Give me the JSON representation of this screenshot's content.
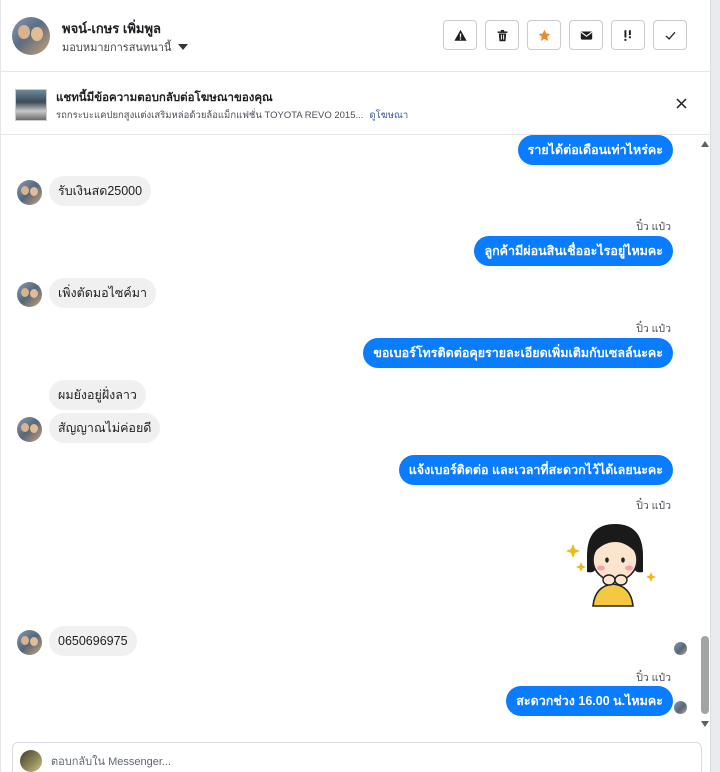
{
  "header": {
    "contact_name": "พจน์-เกษร เพิ่มพูล",
    "assign_label": "มอบหมายการสนทนานี้",
    "actions": [
      {
        "name": "report-icon",
        "label": "warning"
      },
      {
        "name": "trash-icon",
        "label": "delete"
      },
      {
        "name": "star-icon",
        "label": "star",
        "color": "#f08a24"
      },
      {
        "name": "mail-icon",
        "label": "mark unread"
      },
      {
        "name": "follow-up-icon",
        "label": "follow up"
      },
      {
        "name": "check-icon",
        "label": "done"
      }
    ]
  },
  "ad_banner": {
    "title": "แชทนี้มีข้อความตอบกลับต่อโฆษณาของคุณ",
    "subtitle": "รถกระบะแคปยกสูงแต่งเสริมหล่อด้วยล้อแม็กแฟชั่น TOYOTA REVO 2015...",
    "link": "ดูโฆษณา"
  },
  "messages": [
    {
      "dir": "out",
      "text": "รายได้ต่อเดือนเท่าไหร่คะ"
    },
    {
      "dir": "in",
      "text": "รับเงินสด25000"
    },
    {
      "dir": "out",
      "sender": "ปิ๋ว แป๋ว",
      "text": "ลูกค้ามีผ่อนสินเชื่ออะไรอยู่ไหมคะ"
    },
    {
      "dir": "in",
      "text": "เพิ่งตัดมอไซค์มา"
    },
    {
      "dir": "out",
      "sender": "ปิ๋ว แป๋ว",
      "text": "ขอเบอร์โทรติดต่อคุยรายละเอียดเพิ่มเติมกับเซลล์นะคะ"
    },
    {
      "dir": "in",
      "text": "ผมยังอยู่ฝั่งลาว"
    },
    {
      "dir": "in",
      "text": "สัญญาณไม่ค่อยดี"
    },
    {
      "dir": "out",
      "text": "แจ้งเบอร์ติดต่อ  และเวลาที่สะดวกไว้ได้เลยนะคะ"
    },
    {
      "dir": "out",
      "sender": "ปิ๋ว แป๋ว",
      "type": "sticker"
    },
    {
      "dir": "in",
      "text": "0650696975"
    },
    {
      "dir": "out",
      "sender": "ปิ๋ว แป๋ว",
      "text": "สะดวกช่วง 16.00 น.ไหมคะ"
    }
  ],
  "composer": {
    "placeholder": "ตอบกลับใน Messenger..."
  },
  "colors": {
    "outgoing_bubble": "#0a7cff",
    "incoming_bubble": "#f0f0f0",
    "star_accent": "#f08a24"
  }
}
